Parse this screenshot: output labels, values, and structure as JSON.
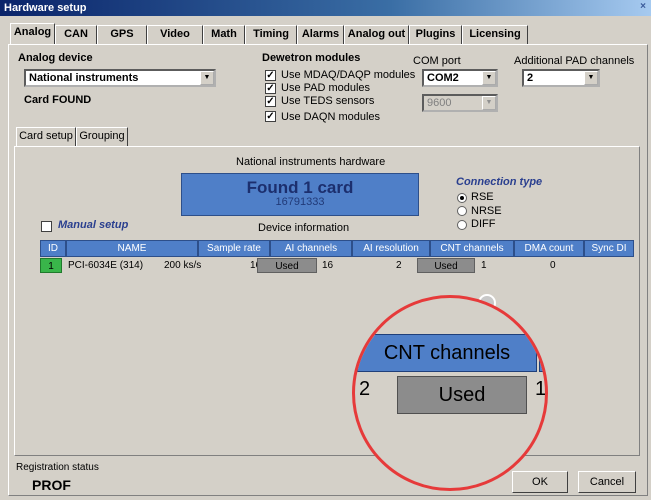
{
  "window": {
    "title": "Hardware setup",
    "close_glyph": "×"
  },
  "tabs": [
    "Analog",
    "CAN",
    "GPS",
    "Video",
    "Math",
    "Timing",
    "Alarms",
    "Analog out",
    "Plugins",
    "Licensing"
  ],
  "analog_device": {
    "label": "Analog device",
    "selected": "National instruments",
    "status": "Card FOUND"
  },
  "dewetron": {
    "label": "Dewetron modules",
    "options": [
      {
        "label": "Use MDAQ/DAQP modules",
        "checked": true
      },
      {
        "label": "Use PAD modules",
        "checked": true
      },
      {
        "label": "Use TEDS sensors",
        "checked": true
      },
      {
        "label": "Use DAQN modules",
        "checked": true
      }
    ]
  },
  "com_port": {
    "label": "COM port",
    "selected": "COM2",
    "baud": "9600"
  },
  "pad_channels": {
    "label": "Additional PAD channels",
    "selected": "2"
  },
  "subtabs": [
    "Card setup",
    "Grouping"
  ],
  "hardware_title": "National instruments hardware",
  "found": {
    "title": "Found 1 card",
    "serial": "16791333"
  },
  "connection": {
    "label": "Connection type",
    "options": [
      {
        "label": "RSE",
        "selected": true
      },
      {
        "label": "NRSE",
        "selected": false
      },
      {
        "label": "DIFF",
        "selected": false
      }
    ]
  },
  "manual_setup": {
    "label": "Manual setup",
    "checked": false
  },
  "device_info_label": "Device information",
  "table": {
    "columns": [
      "ID",
      "NAME",
      "Sample rate",
      "AI channels",
      "AI resolution",
      "CNT channels",
      "DMA count",
      "Sync DI"
    ],
    "row": {
      "id": "1",
      "name": "PCI-6034E (314)",
      "sample_rate": "200 ks/s",
      "ai_channels": "16",
      "ai_used": "Used",
      "ai_resolution": "16",
      "cnt_channels": "2",
      "cnt_used": "Used",
      "dma_count": "1",
      "sync_di": "0"
    }
  },
  "magnifier": {
    "header": "CNT channels",
    "left": "2",
    "used": "Used",
    "right": "1"
  },
  "registration": {
    "label": "Registration status",
    "value": "PROF"
  },
  "buttons": {
    "ok": "OK",
    "cancel": "Cancel"
  },
  "colors": {
    "header_blue": "#4f7fc8",
    "id_green": "#39b54a",
    "used_gray": "#8c8c8c",
    "magnifier_red": "#e63a3a"
  }
}
